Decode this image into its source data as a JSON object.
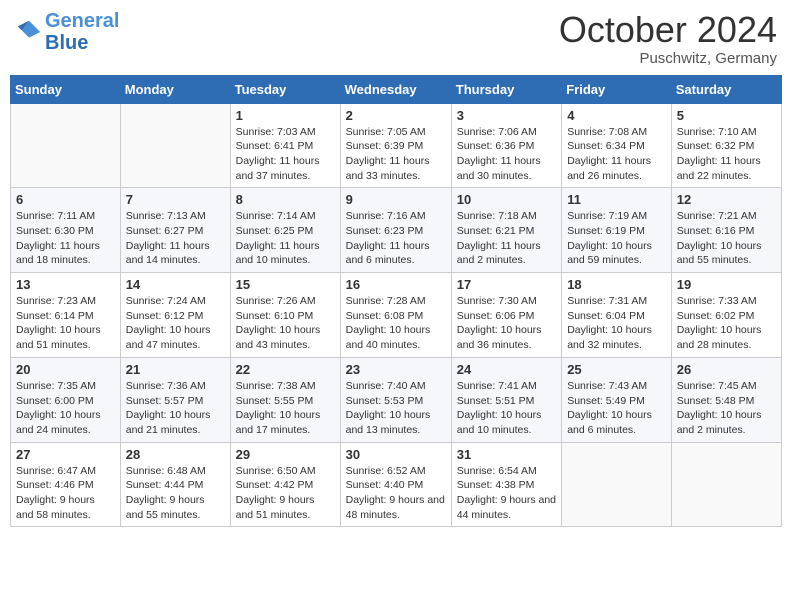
{
  "header": {
    "logo_line1": "General",
    "logo_line2": "Blue",
    "month": "October 2024",
    "location": "Puschwitz, Germany"
  },
  "weekdays": [
    "Sunday",
    "Monday",
    "Tuesday",
    "Wednesday",
    "Thursday",
    "Friday",
    "Saturday"
  ],
  "weeks": [
    [
      {
        "day": "",
        "info": ""
      },
      {
        "day": "",
        "info": ""
      },
      {
        "day": "1",
        "info": "Sunrise: 7:03 AM\nSunset: 6:41 PM\nDaylight: 11 hours and 37 minutes."
      },
      {
        "day": "2",
        "info": "Sunrise: 7:05 AM\nSunset: 6:39 PM\nDaylight: 11 hours and 33 minutes."
      },
      {
        "day": "3",
        "info": "Sunrise: 7:06 AM\nSunset: 6:36 PM\nDaylight: 11 hours and 30 minutes."
      },
      {
        "day": "4",
        "info": "Sunrise: 7:08 AM\nSunset: 6:34 PM\nDaylight: 11 hours and 26 minutes."
      },
      {
        "day": "5",
        "info": "Sunrise: 7:10 AM\nSunset: 6:32 PM\nDaylight: 11 hours and 22 minutes."
      }
    ],
    [
      {
        "day": "6",
        "info": "Sunrise: 7:11 AM\nSunset: 6:30 PM\nDaylight: 11 hours and 18 minutes."
      },
      {
        "day": "7",
        "info": "Sunrise: 7:13 AM\nSunset: 6:27 PM\nDaylight: 11 hours and 14 minutes."
      },
      {
        "day": "8",
        "info": "Sunrise: 7:14 AM\nSunset: 6:25 PM\nDaylight: 11 hours and 10 minutes."
      },
      {
        "day": "9",
        "info": "Sunrise: 7:16 AM\nSunset: 6:23 PM\nDaylight: 11 hours and 6 minutes."
      },
      {
        "day": "10",
        "info": "Sunrise: 7:18 AM\nSunset: 6:21 PM\nDaylight: 11 hours and 2 minutes."
      },
      {
        "day": "11",
        "info": "Sunrise: 7:19 AM\nSunset: 6:19 PM\nDaylight: 10 hours and 59 minutes."
      },
      {
        "day": "12",
        "info": "Sunrise: 7:21 AM\nSunset: 6:16 PM\nDaylight: 10 hours and 55 minutes."
      }
    ],
    [
      {
        "day": "13",
        "info": "Sunrise: 7:23 AM\nSunset: 6:14 PM\nDaylight: 10 hours and 51 minutes."
      },
      {
        "day": "14",
        "info": "Sunrise: 7:24 AM\nSunset: 6:12 PM\nDaylight: 10 hours and 47 minutes."
      },
      {
        "day": "15",
        "info": "Sunrise: 7:26 AM\nSunset: 6:10 PM\nDaylight: 10 hours and 43 minutes."
      },
      {
        "day": "16",
        "info": "Sunrise: 7:28 AM\nSunset: 6:08 PM\nDaylight: 10 hours and 40 minutes."
      },
      {
        "day": "17",
        "info": "Sunrise: 7:30 AM\nSunset: 6:06 PM\nDaylight: 10 hours and 36 minutes."
      },
      {
        "day": "18",
        "info": "Sunrise: 7:31 AM\nSunset: 6:04 PM\nDaylight: 10 hours and 32 minutes."
      },
      {
        "day": "19",
        "info": "Sunrise: 7:33 AM\nSunset: 6:02 PM\nDaylight: 10 hours and 28 minutes."
      }
    ],
    [
      {
        "day": "20",
        "info": "Sunrise: 7:35 AM\nSunset: 6:00 PM\nDaylight: 10 hours and 24 minutes."
      },
      {
        "day": "21",
        "info": "Sunrise: 7:36 AM\nSunset: 5:57 PM\nDaylight: 10 hours and 21 minutes."
      },
      {
        "day": "22",
        "info": "Sunrise: 7:38 AM\nSunset: 5:55 PM\nDaylight: 10 hours and 17 minutes."
      },
      {
        "day": "23",
        "info": "Sunrise: 7:40 AM\nSunset: 5:53 PM\nDaylight: 10 hours and 13 minutes."
      },
      {
        "day": "24",
        "info": "Sunrise: 7:41 AM\nSunset: 5:51 PM\nDaylight: 10 hours and 10 minutes."
      },
      {
        "day": "25",
        "info": "Sunrise: 7:43 AM\nSunset: 5:49 PM\nDaylight: 10 hours and 6 minutes."
      },
      {
        "day": "26",
        "info": "Sunrise: 7:45 AM\nSunset: 5:48 PM\nDaylight: 10 hours and 2 minutes."
      }
    ],
    [
      {
        "day": "27",
        "info": "Sunrise: 6:47 AM\nSunset: 4:46 PM\nDaylight: 9 hours and 58 minutes."
      },
      {
        "day": "28",
        "info": "Sunrise: 6:48 AM\nSunset: 4:44 PM\nDaylight: 9 hours and 55 minutes."
      },
      {
        "day": "29",
        "info": "Sunrise: 6:50 AM\nSunset: 4:42 PM\nDaylight: 9 hours and 51 minutes."
      },
      {
        "day": "30",
        "info": "Sunrise: 6:52 AM\nSunset: 4:40 PM\nDaylight: 9 hours and 48 minutes."
      },
      {
        "day": "31",
        "info": "Sunrise: 6:54 AM\nSunset: 4:38 PM\nDaylight: 9 hours and 44 minutes."
      },
      {
        "day": "",
        "info": ""
      },
      {
        "day": "",
        "info": ""
      }
    ]
  ]
}
